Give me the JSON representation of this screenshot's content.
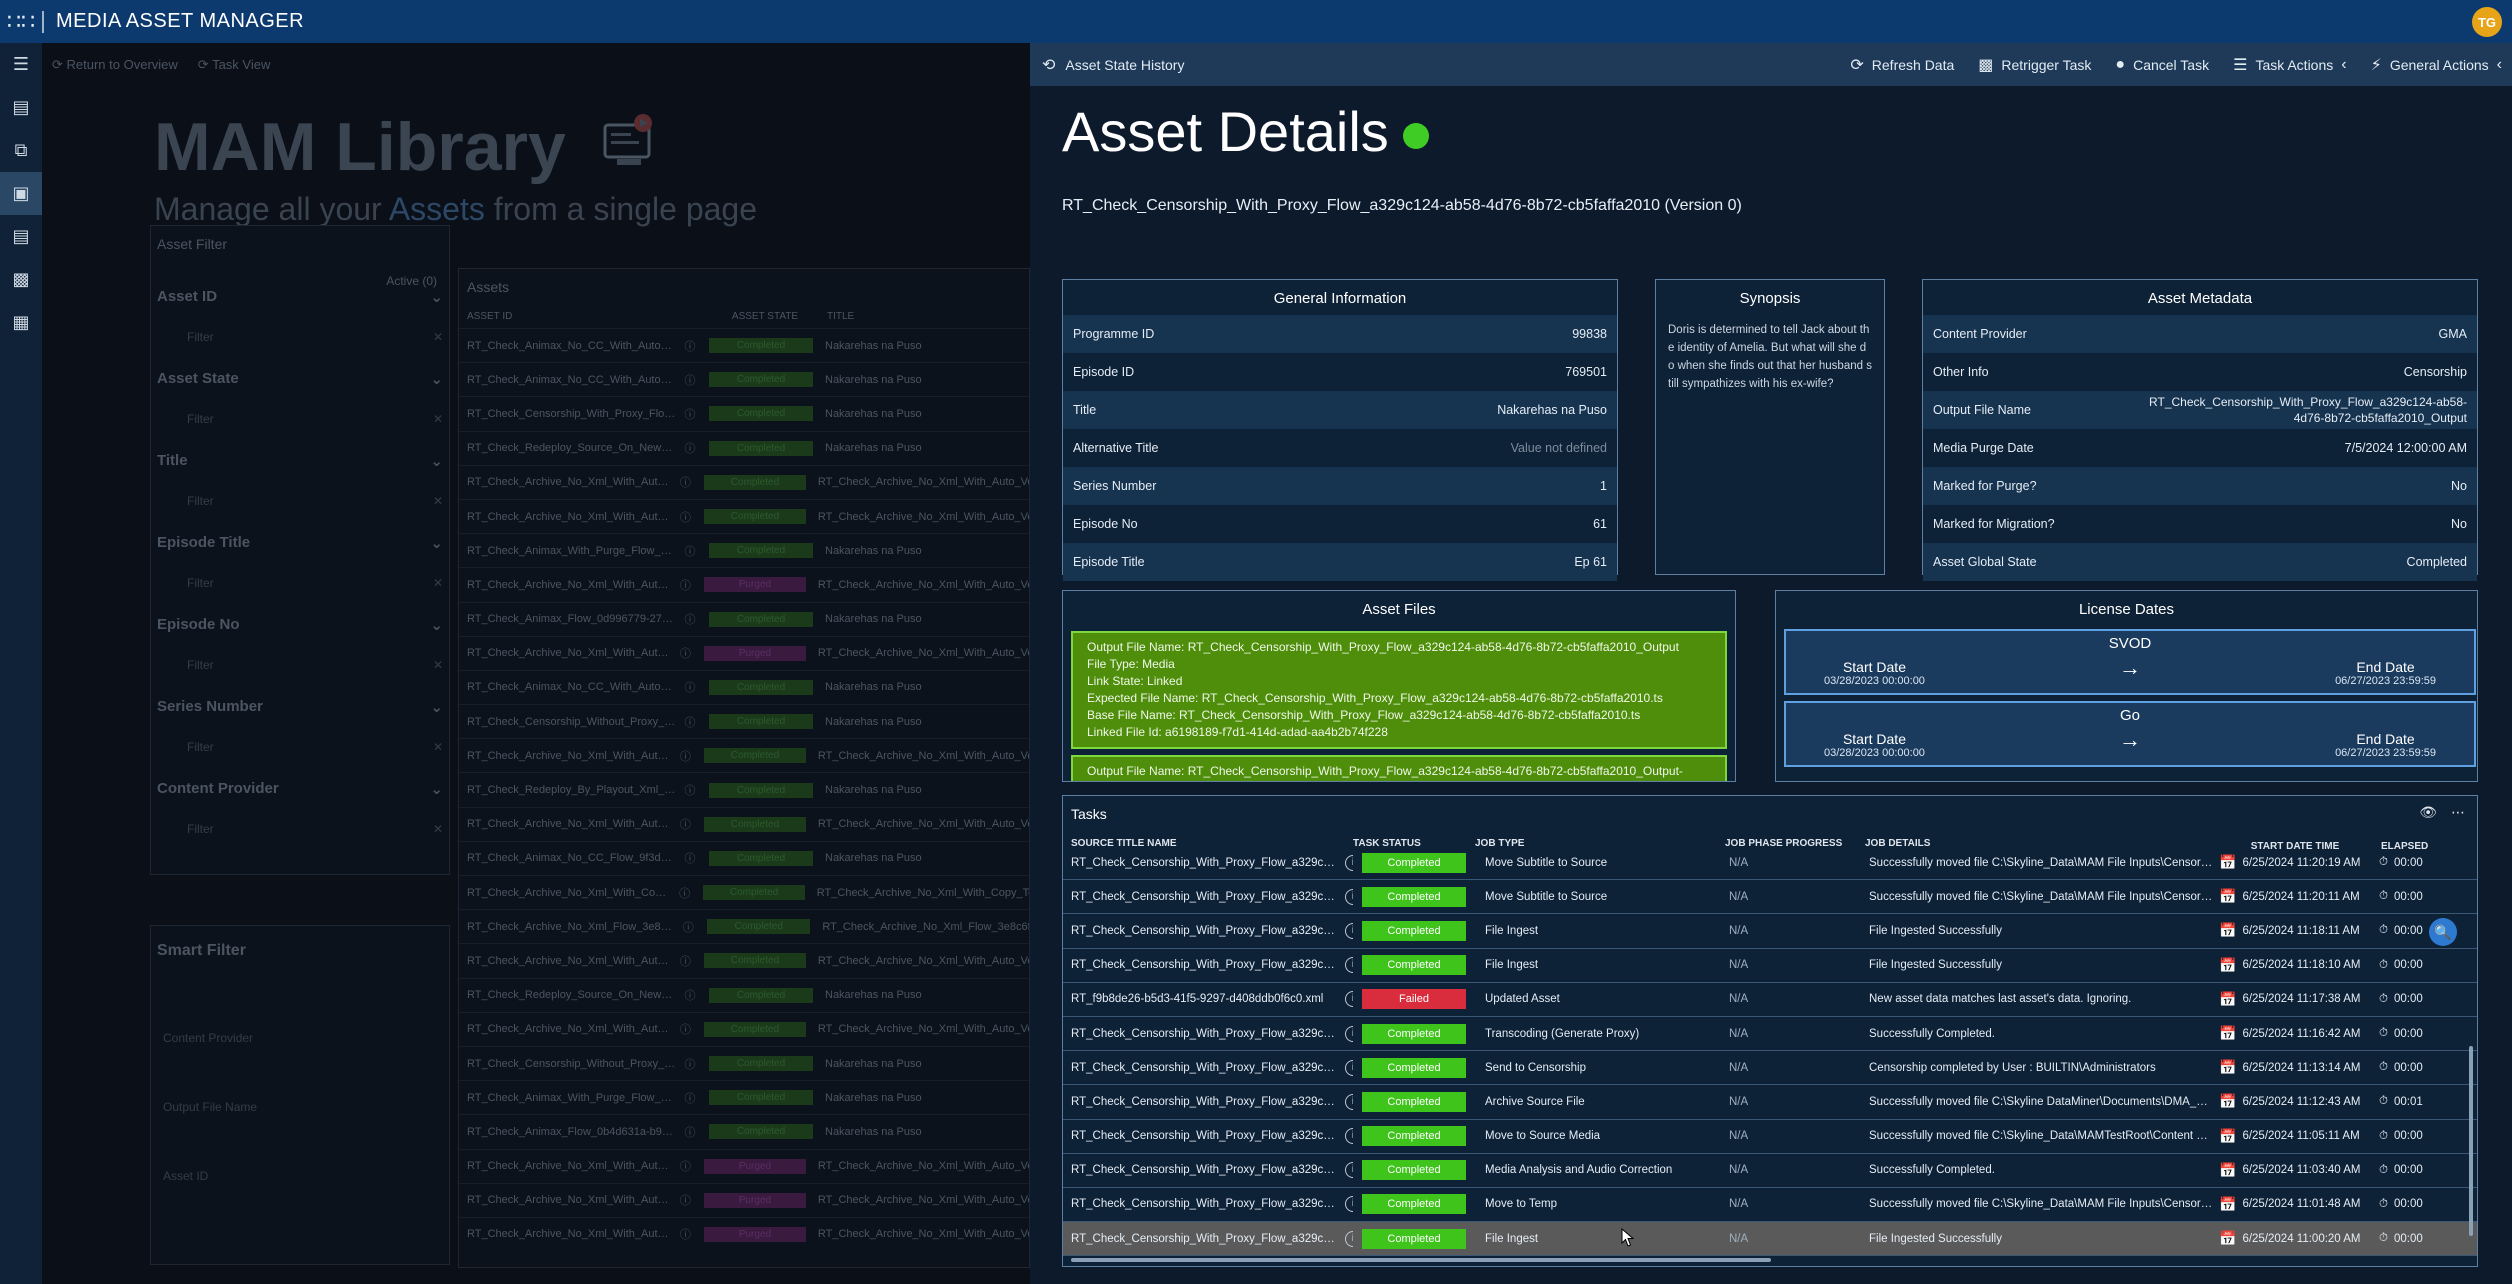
{
  "app": {
    "title": "MEDIA ASSET MANAGER",
    "user_initials": "TG"
  },
  "sidebar": {
    "icons": [
      "menu-icon",
      "dashboard-icon",
      "workflow-icon",
      "library-icon",
      "document-icon",
      "image-icon",
      "settings-icon"
    ]
  },
  "background": {
    "breadcrumb": {
      "back": "Return to Overview",
      "task_view": "Task View"
    },
    "title": "MAM Library",
    "subtitle_pre": "Manage all your ",
    "subtitle_hl": "Assets",
    "subtitle_post": " from a single page",
    "filter": {
      "title": "Asset Filter",
      "active_label": "Active (0)",
      "groups": [
        {
          "label": "Asset ID",
          "placeholder": "Filter"
        },
        {
          "label": "Asset State",
          "placeholder": "Filter"
        },
        {
          "label": "Title",
          "placeholder": "Filter"
        },
        {
          "label": "Episode Title",
          "placeholder": "Filter"
        },
        {
          "label": "Episode No",
          "placeholder": "Filter"
        },
        {
          "label": "Series Number",
          "placeholder": "Filter"
        },
        {
          "label": "Content Provider",
          "placeholder": "Filter"
        }
      ]
    },
    "smart_filter": {
      "title": "Smart Filter",
      "items": [
        "Content Provider",
        "Output File Name",
        "Asset ID"
      ]
    },
    "assets": {
      "title": "Assets",
      "headers": [
        "ASSET ID",
        "ASSET STATE",
        "TITLE"
      ],
      "rows": [
        {
          "id": "RT_Check_Animax_No_CC_With_Auto_Ve...",
          "state": "Completed",
          "title": "Nakarehas na Puso"
        },
        {
          "id": "RT_Check_Animax_No_CC_With_Auto_Ve...",
          "state": "Completed",
          "title": "Nakarehas na Puso"
        },
        {
          "id": "RT_Check_Censorship_With_Proxy_Flow_...",
          "state": "Completed",
          "title": "Nakarehas na Puso"
        },
        {
          "id": "RT_Check_Redeploy_Source_On_New_Se...",
          "state": "Completed",
          "title": "Nakarehas na Puso"
        },
        {
          "id": "RT_Check_Archive_No_Xml_With_Auto_V...",
          "state": "Completed",
          "title": "RT_Check_Archive_No_Xml_With_Auto_Ve"
        },
        {
          "id": "RT_Check_Archive_No_Xml_With_Auto_V...",
          "state": "Completed",
          "title": "RT_Check_Archive_No_Xml_With_Auto_Ve"
        },
        {
          "id": "RT_Check_Animax_With_Purge_Flow_445...",
          "state": "Completed",
          "title": "Nakarehas na Puso"
        },
        {
          "id": "RT_Check_Archive_No_Xml_With_Auto_V...",
          "state": "Purged",
          "title": "RT_Check_Archive_No_Xml_With_Auto_Ve"
        },
        {
          "id": "RT_Check_Animax_Flow_0d996779-2717...",
          "state": "Completed",
          "title": "Nakarehas na Puso"
        },
        {
          "id": "RT_Check_Archive_No_Xml_With_Auto_V...",
          "state": "Purged",
          "title": "RT_Check_Archive_No_Xml_With_Auto_Ve"
        },
        {
          "id": "RT_Check_Animax_No_CC_With_Auto_Ve...",
          "state": "Completed",
          "title": "Nakarehas na Puso"
        },
        {
          "id": "RT_Check_Censorship_Without_Proxy_Flo...",
          "state": "Completed",
          "title": "Nakarehas na Puso"
        },
        {
          "id": "RT_Check_Archive_No_Xml_With_Auto_V...",
          "state": "Completed",
          "title": "RT_Check_Archive_No_Xml_With_Auto_Ve"
        },
        {
          "id": "RT_Check_Redeploy_By_Playout_Xml_Flo...",
          "state": "Completed",
          "title": "Nakarehas na Puso"
        },
        {
          "id": "RT_Check_Archive_No_Xml_With_Auto_V...",
          "state": "Completed",
          "title": "RT_Check_Archive_No_Xml_With_Auto_Ve"
        },
        {
          "id": "RT_Check_Animax_No_CC_Flow_9f3d046...",
          "state": "Completed",
          "title": "Nakarehas na Puso"
        },
        {
          "id": "RT_Check_Archive_No_Xml_With_Copy_T...",
          "state": "Completed",
          "title": "RT_Check_Archive_No_Xml_With_Copy_To"
        },
        {
          "id": "RT_Check_Archive_No_Xml_Flow_3e8c6f...",
          "state": "Completed",
          "title": "RT_Check_Archive_No_Xml_Flow_3e8c6f"
        },
        {
          "id": "RT_Check_Archive_No_Xml_With_Auto_V...",
          "state": "Completed",
          "title": "RT_Check_Archive_No_Xml_With_Auto_Ve"
        },
        {
          "id": "RT_Check_Redeploy_Source_On_New_Se...",
          "state": "Completed",
          "title": "Nakarehas na Puso"
        },
        {
          "id": "RT_Check_Archive_No_Xml_With_Auto_V...",
          "state": "Completed",
          "title": "RT_Check_Archive_No_Xml_With_Auto_Ve"
        },
        {
          "id": "RT_Check_Censorship_Without_Proxy_Flo...",
          "state": "Completed",
          "title": "Nakarehas na Puso"
        },
        {
          "id": "RT_Check_Animax_With_Purge_Flow_c0d...",
          "state": "Completed",
          "title": "Nakarehas na Puso"
        },
        {
          "id": "RT_Check_Animax_Flow_0b4d631a-b943...",
          "state": "Completed",
          "title": "Nakarehas na Puso"
        },
        {
          "id": "RT_Check_Archive_No_Xml_With_Auto_V...",
          "state": "Purged",
          "title": "RT_Check_Archive_No_Xml_With_Auto_Ve"
        },
        {
          "id": "RT_Check_Archive_No_Xml_With_Auto_V...",
          "state": "Purged",
          "title": "RT_Check_Archive_No_Xml_With_Auto_Ve"
        },
        {
          "id": "RT_Check_Archive_No_Xml_With_Auto_V...",
          "state": "Purged",
          "title": "RT_Check_Archive_No_Xml_With_Auto_Ve"
        }
      ]
    }
  },
  "toolbar": {
    "history": "Asset State History",
    "refresh": "Refresh Data",
    "retrigger": "Retrigger Task",
    "cancel": "Cancel Task",
    "task_actions": "Task Actions",
    "general_actions": "General Actions"
  },
  "details": {
    "title": "Asset Details",
    "status_color": "#3fcc25",
    "subtitle": "RT_Check_Censorship_With_Proxy_Flow_a329c124-ab58-4d76-8b72-cb5faffa2010 (Version 0)"
  },
  "general_info": {
    "title": "General Information",
    "rows": [
      {
        "k": "Programme ID",
        "v": "99838"
      },
      {
        "k": "Episode ID",
        "v": "769501"
      },
      {
        "k": "Title",
        "v": "Nakarehas na Puso"
      },
      {
        "k": "Alternative Title",
        "v": "Value not defined"
      },
      {
        "k": "Series Number",
        "v": "1"
      },
      {
        "k": "Episode No",
        "v": "61"
      },
      {
        "k": "Episode Title",
        "v": "Ep 61"
      }
    ]
  },
  "synopsis": {
    "title": "Synopsis",
    "text": "Doris is determined to tell Jack about the identity of Amelia. But what will she do when she finds out that her husband still sympathizes with his ex-wife?"
  },
  "asset_metadata": {
    "title": "Asset Metadata",
    "rows": [
      {
        "k": "Content Provider",
        "v": "GMA"
      },
      {
        "k": "Other Info",
        "v": "Censorship"
      },
      {
        "k": "Output File Name",
        "v": "RT_Check_Censorship_With_Proxy_Flow_a329c124-ab58-4d76-8b72-cb5faffa2010_Output"
      },
      {
        "k": "Media Purge Date",
        "v": "7/5/2024 12:00:00 AM"
      },
      {
        "k": "Marked for Purge?",
        "v": "No"
      },
      {
        "k": "Marked for Migration?",
        "v": "No"
      },
      {
        "k": "Asset Global State",
        "v": "Completed"
      }
    ]
  },
  "asset_files": {
    "title": "Asset Files",
    "file": {
      "output": "Output File Name: RT_Check_Censorship_With_Proxy_Flow_a329c124-ab58-4d76-8b72-cb5faffa2010_Output",
      "type": "File Type: Media",
      "link": "Link State: Linked",
      "expected": "Expected File Name: RT_Check_Censorship_With_Proxy_Flow_a329c124-ab58-4d76-8b72-cb5faffa2010.ts",
      "base": "Base File Name: RT_Check_Censorship_With_Proxy_Flow_a329c124-ab58-4d76-8b72-cb5faffa2010.ts",
      "linked_id": "Linked File Id: a6198189-f7d1-414d-adad-aa4b2b74f228"
    },
    "file2_partial": "Output File Name: RT_Check_Censorship_With_Proxy_Flow_a329c124-ab58-4d76-8b72-cb5faffa2010_Output-ENG.pac"
  },
  "license": {
    "title": "License Dates",
    "items": [
      {
        "name": "SVOD",
        "start_label": "Start Date",
        "start": "03/28/2023 00:00:00",
        "end_label": "End Date",
        "end": "06/27/2023 23:59:59"
      },
      {
        "name": "Go",
        "start_label": "Start Date",
        "start": "03/28/2023 00:00:00",
        "end_label": "End Date",
        "end": "06/27/2023 23:59:59"
      }
    ]
  },
  "tasks": {
    "title": "Tasks",
    "headers": [
      "SOURCE TITLE NAME",
      "TASK STATUS",
      "JOB TYPE",
      "JOB PHASE PROGRESS",
      "JOB DETAILS",
      "START DATE TIME",
      "ELAPSED"
    ],
    "rows": [
      {
        "src": "RT_Check_Censorship_With_Proxy_Flow_a329c124-ab58-4d...",
        "status": "Completed",
        "job": "Move Subtitle to Source",
        "progress": "N/A",
        "details": "Successfully moved file C:\\Skyline_Data\\MAM File Inputs\\Censorship...",
        "start": "6/25/2024 11:20:19 AM",
        "elapsed": "00:00"
      },
      {
        "src": "RT_Check_Censorship_With_Proxy_Flow_a329c124-ab58-4d...",
        "status": "Completed",
        "job": "Move Subtitle to Source",
        "progress": "N/A",
        "details": "Successfully moved file C:\\Skyline_Data\\MAM File Inputs\\Censorship...",
        "start": "6/25/2024 11:20:11 AM",
        "elapsed": "00:00"
      },
      {
        "src": "RT_Check_Censorship_With_Proxy_Flow_a329c124-ab58-4d...",
        "status": "Completed",
        "job": "File Ingest",
        "progress": "N/A",
        "details": "File Ingested Successfully",
        "start": "6/25/2024 11:18:11 AM",
        "elapsed": "00:00"
      },
      {
        "src": "RT_Check_Censorship_With_Proxy_Flow_a329c124-ab58-4d...",
        "status": "Completed",
        "job": "File Ingest",
        "progress": "N/A",
        "details": "File Ingested Successfully",
        "start": "6/25/2024 11:18:10 AM",
        "elapsed": "00:00"
      },
      {
        "src": "RT_f9b8de26-b5d3-41f5-9297-d408ddb0f6c0.xml",
        "status": "Failed",
        "job": "Updated Asset",
        "progress": "N/A",
        "details": "New asset data matches last asset's data. Ignoring.",
        "start": "6/25/2024 11:17:38 AM",
        "elapsed": "00:00"
      },
      {
        "src": "RT_Check_Censorship_With_Proxy_Flow_a329c124-ab58-4d...",
        "status": "Completed",
        "job": "Transcoding (Generate Proxy)",
        "progress": "N/A",
        "details": "Successfully Completed.",
        "start": "6/25/2024 11:16:42 AM",
        "elapsed": "00:00"
      },
      {
        "src": "RT_Check_Censorship_With_Proxy_Flow_a329c124-ab58-4d...",
        "status": "Completed",
        "job": "Send to Censorship",
        "progress": "N/A",
        "details": "Censorship completed by User : BUILTIN\\Administrators",
        "start": "6/25/2024 11:13:14 AM",
        "elapsed": "00:00"
      },
      {
        "src": "RT_Check_Censorship_With_Proxy_Flow_a329c124-ab58-4d...",
        "status": "Completed",
        "job": "Archive Source File",
        "progress": "N/A",
        "details": "Successfully moved file C:\\Skyline DataMiner\\Documents\\DMA_COM...",
        "start": "6/25/2024 11:12:43 AM",
        "elapsed": "00:01"
      },
      {
        "src": "RT_Check_Censorship_With_Proxy_Flow_a329c124-ab58-4d...",
        "status": "Completed",
        "job": "Move to Source Media",
        "progress": "N/A",
        "details": "Successfully moved file C:\\Skyline_Data\\MAMTestRoot\\Content Provi...",
        "start": "6/25/2024 11:05:11 AM",
        "elapsed": "00:00"
      },
      {
        "src": "RT_Check_Censorship_With_Proxy_Flow_a329c124-ab58-4d...",
        "status": "Completed",
        "job": "Media Analysis and Audio Correction",
        "progress": "N/A",
        "details": "Successfully Completed.",
        "start": "6/25/2024 11:03:40 AM",
        "elapsed": "00:00"
      },
      {
        "src": "RT_Check_Censorship_With_Proxy_Flow_a329c124-ab58-4d...",
        "status": "Completed",
        "job": "Move to Temp",
        "progress": "N/A",
        "details": "Successfully moved file C:\\Skyline_Data\\MAM File Inputs\\Censorship...",
        "start": "6/25/2024 11:01:48 AM",
        "elapsed": "00:00"
      },
      {
        "src": "RT_Check_Censorship_With_Proxy_Flow_a329c124-ab58-4d...",
        "status": "Completed",
        "job": "File Ingest",
        "progress": "N/A",
        "details": "File Ingested Successfully",
        "start": "6/25/2024 11:00:20 AM",
        "elapsed": "00:00"
      }
    ]
  }
}
